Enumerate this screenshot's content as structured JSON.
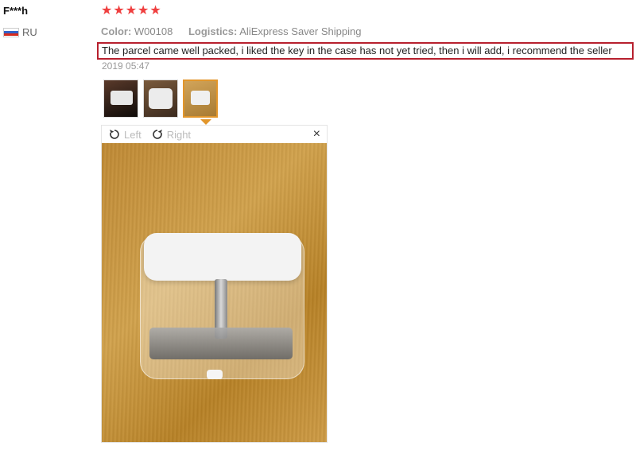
{
  "review": {
    "reviewer": "F***h",
    "country": "RU",
    "rating": 5,
    "color_label": "Color:",
    "color_value": "W00108",
    "logistics_label": "Logistics:",
    "logistics_value": "AliExpress Saver Shipping",
    "feedback": "The parcel came well packed, i liked the key in the case has not yet tried, then i will add, i recommend the seller",
    "date": "2019 05:47"
  },
  "thumbnails": [
    {
      "name": "photo-thumbnail-1",
      "active": false
    },
    {
      "name": "photo-thumbnail-2",
      "active": false
    },
    {
      "name": "photo-thumbnail-3",
      "active": true
    }
  ],
  "viewer": {
    "rotate_left": "Left",
    "rotate_right": "Right",
    "close_symbol": "×"
  },
  "colors": {
    "star": "#ef3f3f",
    "highlight_border": "#b7202e",
    "active_thumb": "#e2962b"
  }
}
